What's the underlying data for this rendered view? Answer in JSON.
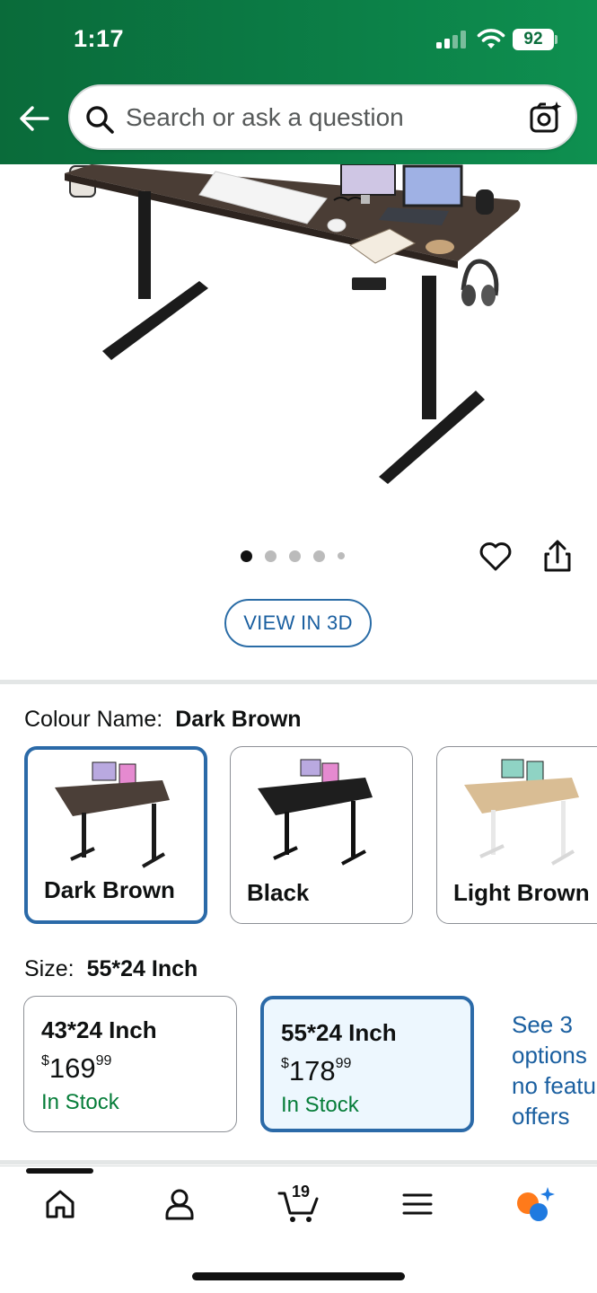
{
  "status_bar": {
    "time": "1:17",
    "battery": "92"
  },
  "search": {
    "placeholder": "Search or ask a question"
  },
  "product_gallery": {
    "image_count": 5,
    "active_index": 0
  },
  "view_3d_label": "VIEW IN 3D",
  "colour": {
    "label": "Colour Name:",
    "selected": "Dark Brown",
    "options": [
      {
        "label": "Dark Brown",
        "top_color": "#4b3f38",
        "frame_color": "#1a1a1a"
      },
      {
        "label": "Black",
        "top_color": "#1e1e1e",
        "frame_color": "#111111"
      },
      {
        "label": "Light Brown",
        "top_color": "#d9bd94",
        "frame_color": "#e8e8e8"
      }
    ]
  },
  "size": {
    "label": "Size:",
    "selected": "55*24 Inch",
    "options": [
      {
        "title": "43*24 Inch",
        "currency": "$",
        "price_whole": "169",
        "price_fraction": "99",
        "stock": "In Stock"
      },
      {
        "title": "55*24 Inch",
        "currency": "$",
        "price_whole": "178",
        "price_fraction": "99",
        "stock": "In Stock"
      }
    ],
    "see_more_lines": [
      "See 3",
      "options",
      "no featu",
      "offers"
    ]
  },
  "bottom_nav": {
    "cart_count": "19"
  },
  "colors": {
    "header_green": "#0b7a44",
    "link_blue": "#1a5fa0",
    "selected_border": "#2b6aa8",
    "in_stock_green": "#067d39"
  }
}
